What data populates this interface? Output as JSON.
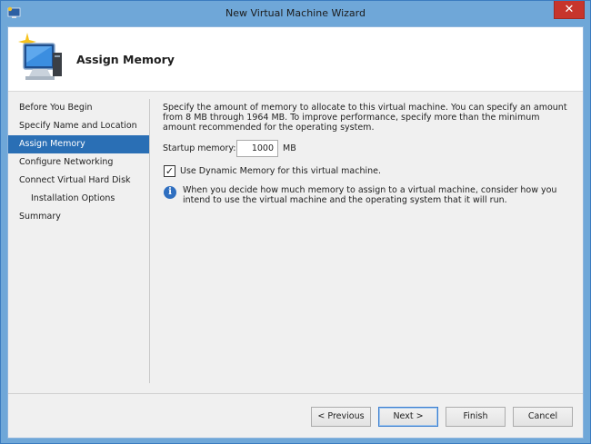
{
  "window": {
    "title": "New Virtual Machine Wizard",
    "close_glyph": "✕"
  },
  "header": {
    "title": "Assign Memory",
    "icon": "virtual-machine-icon"
  },
  "nav": {
    "items": [
      {
        "label": "Before You Begin",
        "selected": false,
        "sub": false
      },
      {
        "label": "Specify Name and Location",
        "selected": false,
        "sub": false
      },
      {
        "label": "Assign Memory",
        "selected": true,
        "sub": false
      },
      {
        "label": "Configure Networking",
        "selected": false,
        "sub": false
      },
      {
        "label": "Connect Virtual Hard Disk",
        "selected": false,
        "sub": false
      },
      {
        "label": "Installation Options",
        "selected": false,
        "sub": true
      },
      {
        "label": "Summary",
        "selected": false,
        "sub": false
      }
    ]
  },
  "content": {
    "description": "Specify the amount of memory to allocate to this virtual machine. You can specify an amount from 8 MB through 1964 MB. To improve performance, specify more than the minimum amount recommended for the operating system.",
    "startup_label": "Startup memory:",
    "startup_value": "1000",
    "startup_unit": "MB",
    "dynamic_memory_label": "Use Dynamic Memory for this virtual machine.",
    "dynamic_memory_checked": true,
    "info_text": "When you decide how much memory to assign to a virtual machine, consider how you intend to use the virtual machine and the operating system that it will run."
  },
  "buttons": {
    "previous": "< Previous",
    "next": "Next >",
    "finish": "Finish",
    "cancel": "Cancel"
  },
  "colors": {
    "title_bar": "#6fa7d8",
    "selection": "#2a6fb5",
    "close": "#c7352c"
  }
}
